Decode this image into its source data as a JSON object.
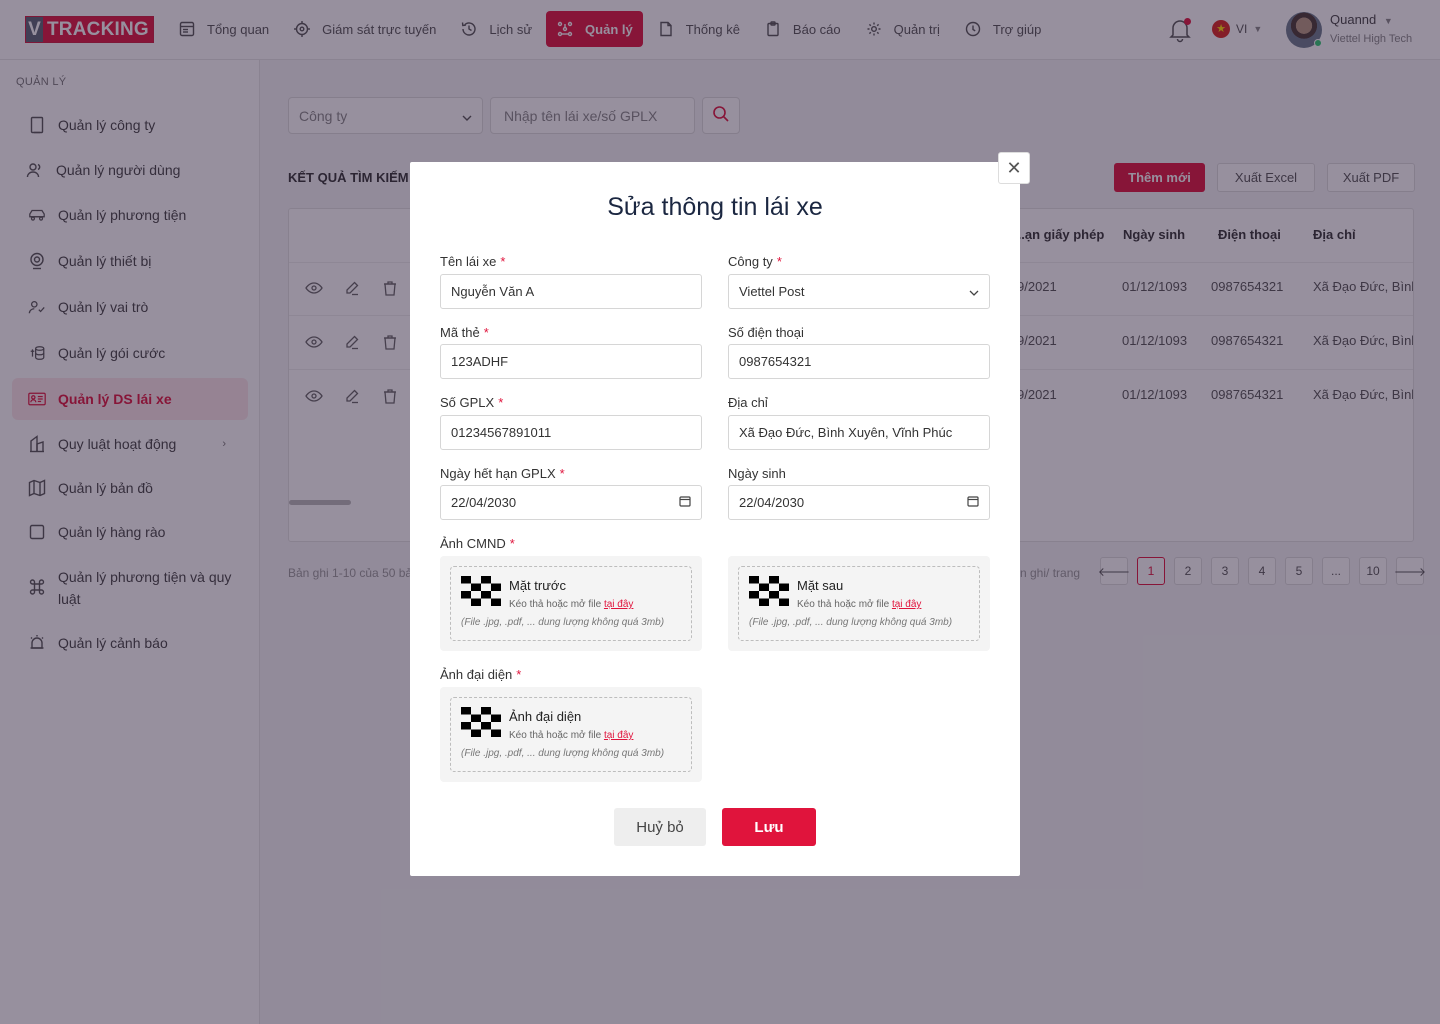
{
  "header": {
    "logo_v": "V",
    "logo_text": "TRACKING",
    "nav": [
      {
        "label": "Tổng quan",
        "icon": "dashboard-icon"
      },
      {
        "label": "Giám sát trực tuyến",
        "icon": "crosshair-icon"
      },
      {
        "label": "Lịch sử",
        "icon": "history-icon"
      },
      {
        "label": "Quản lý",
        "icon": "manage-icon",
        "active": true
      },
      {
        "label": "Thống kê",
        "icon": "file-icon"
      },
      {
        "label": "Báo cáo",
        "icon": "clipboard-icon"
      },
      {
        "label": "Quản trị",
        "icon": "gear-icon"
      },
      {
        "label": "Trợ giúp",
        "icon": "help-icon"
      }
    ],
    "lang": "VI",
    "user_name": "Quannd",
    "user_org": "Viettel High Tech",
    "accent_color": "#e0143c"
  },
  "sidebar": {
    "title": "QUẢN LÝ",
    "items": [
      {
        "label": "Quản lý công ty",
        "icon": "building-icon"
      },
      {
        "label": "Quản lý người dùng",
        "icon": "users-icon"
      },
      {
        "label": "Quản lý phương tiện",
        "icon": "car-icon"
      },
      {
        "label": "Quản lý thiết bị",
        "icon": "device-icon"
      },
      {
        "label": "Quản lý vai trò",
        "icon": "user-check-icon"
      },
      {
        "label": "Quản lý gói cước",
        "icon": "coins-icon"
      },
      {
        "label": "Quản lý DS lái xe",
        "icon": "id-card-icon",
        "active": true
      },
      {
        "label": "Quy luật hoạt động",
        "icon": "rules-icon",
        "has_children": true
      },
      {
        "label": "Quản lý bản đồ",
        "icon": "map-icon"
      },
      {
        "label": "Quản lý hàng rào",
        "icon": "square-icon"
      },
      {
        "label": "Quản lý phương tiện và quy luật",
        "icon": "command-icon"
      },
      {
        "label": "Quản lý cảnh báo",
        "icon": "alarm-icon"
      }
    ]
  },
  "main": {
    "company_placeholder": "Công ty",
    "search_placeholder": "Nhập tên lái xe/số GPLX",
    "result_title": "KẾT QUẢ TÌM KIẾM",
    "add_label": "Thêm mới",
    "excel_label": "Xuất Excel",
    "pdf_label": "Xuất PDF",
    "columns": [
      "...ạn giấy phép",
      "Ngày sinh",
      "Điện thoại",
      "Địa chỉ"
    ],
    "rows": [
      {
        "expiry": "9/2021",
        "dob": "01/12/1093",
        "phone": "0987654321",
        "address": "Xã Đạo Đức, Bình"
      },
      {
        "expiry": "9/2021",
        "dob": "01/12/1093",
        "phone": "0987654321",
        "address": "Xã Đạo Đức, Bình"
      },
      {
        "expiry": "9/2021",
        "dob": "01/12/1093",
        "phone": "0987654321",
        "address": "Xã Đạo Đức, Bình"
      }
    ],
    "footer_info": "Bản ghi 1-10 của 50 bả",
    "footer_per": "n ghi/ trang",
    "pages": [
      "1",
      "2",
      "3",
      "4",
      "5",
      "...",
      "10"
    ],
    "current_page": "1"
  },
  "modal": {
    "title": "Sửa thông tin lái xe",
    "name_label": "Tên lái xe",
    "name_value": "Nguyễn Văn A",
    "company_label": "Công ty",
    "company_value": "Viettel Post",
    "card_label": "Mã thẻ",
    "card_value": "123ADHF",
    "phone_label": "Số điện thoại",
    "phone_value": "0987654321",
    "license_label": "Số GPLX",
    "license_value": "01234567891011",
    "address_label": "Địa chỉ",
    "address_value": "Xã Đạo Đức, Bình Xuyên, Vĩnh Phúc",
    "expiry_label": "Ngày hết hạn GPLX",
    "expiry_value": "22/04/2030",
    "dob_label": "Ngày sinh",
    "dob_value": "22/04/2030",
    "id_photo_label": "Ảnh CMND",
    "front_title": "Mặt trước",
    "back_title": "Mặt sau",
    "avatar_label": "Ảnh đại diện",
    "avatar_title": "Ảnh đại diện",
    "upload_hint": "Kéo thả hoặc mở file",
    "upload_link": "tại đây",
    "upload_note": "(File .jpg, .pdf, ... dung lượng không quá 3mb)",
    "cancel_label": "Huỷ bỏ",
    "save_label": "Lưu",
    "required_mark": "*"
  }
}
